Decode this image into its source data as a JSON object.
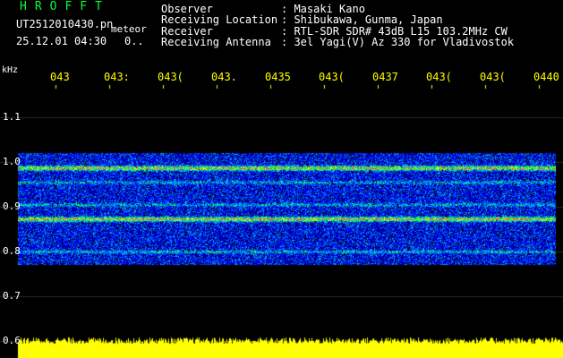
{
  "header": {
    "logo": "HROFFT",
    "filename": "UT2512010430.pn",
    "meteor_label": "meteor",
    "datetime": "25.12.01 04:30",
    "count": "0..",
    "info": [
      {
        "label": "Observer",
        "value": ": Masaki Kano"
      },
      {
        "label": "Receiving Location",
        "value": ": Shibukawa, Gunma, Japan"
      },
      {
        "label": "Receiver",
        "value": ": RTL-SDR SDR# 43dB L15 103.2MHz CW"
      },
      {
        "label": "Receiving Antenna",
        "value": ": 3el Yagi(V) Az 330 for Vladivostok"
      }
    ]
  },
  "axes": {
    "y_unit": "kHz",
    "y_ticks": [
      "1.1",
      "1.0",
      "0.9",
      "0.8",
      "0.7",
      "0.6"
    ],
    "y_tick_values": [
      1.1,
      1.0,
      0.9,
      0.8,
      0.7,
      0.6
    ],
    "time_ticks": [
      "043",
      "043:",
      "043(",
      "043.",
      "0435",
      "043(",
      "0437",
      "043(",
      "043(",
      "0440"
    ]
  },
  "colors": {
    "background": "#000000",
    "tick_labels": "#ffff00",
    "logo": "#00ff3c",
    "power_bar": "#ffff00",
    "signal_band": "#ff3c64"
  },
  "spectrogram": {
    "noise_band_khz": [
      0.77,
      1.02
    ],
    "strong_lines_khz": [
      0.873,
      0.987
    ],
    "medium_lines_khz": [
      0.8,
      0.905,
      0.955
    ]
  }
}
